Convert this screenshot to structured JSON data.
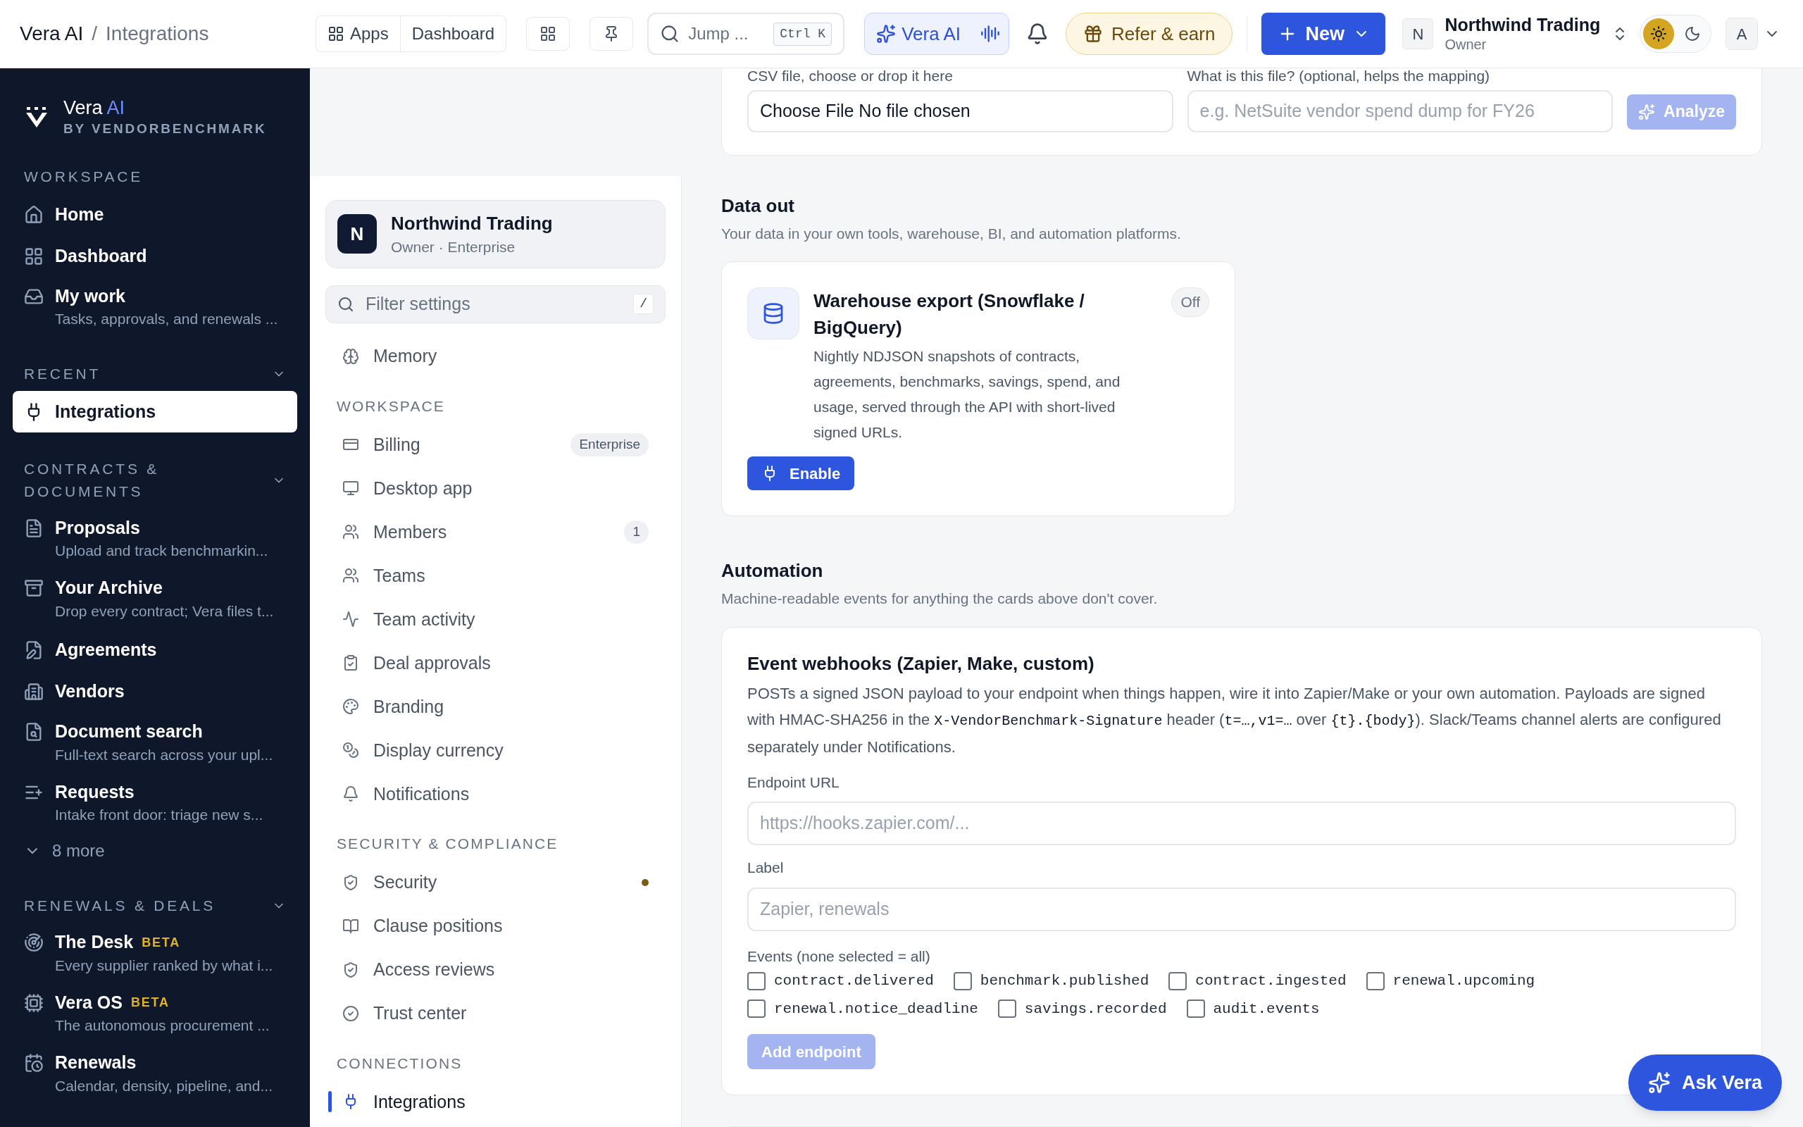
{
  "topbar": {
    "breadcrumb": [
      "Vera AI",
      "/",
      "Integrations"
    ],
    "apps_group": [
      {
        "label": "Apps",
        "kind": "grid"
      },
      {
        "label": "Dashboard"
      }
    ],
    "search": {
      "placeholder": "Jump ...",
      "shortcut": "Ctrl K"
    },
    "vera_button": "Vera AI",
    "refer_button": "Refer & earn",
    "new_button": "New",
    "account": {
      "initial": "N",
      "name": "Northwind Trading",
      "role": "Owner"
    },
    "theme": [
      {
        "kind": "light",
        "selected": true
      },
      {
        "kind": "dark",
        "selected": false
      }
    ],
    "user_initial": "A"
  },
  "sidebar": {
    "brand": {
      "name": "Vera",
      "accent": "AI",
      "subtitle": "BY VENDORBENCHMARK"
    },
    "sections": [
      {
        "title": "WORKSPACE",
        "collapsible": false,
        "items": [
          {
            "label": "Home",
            "kind": "home",
            "selected": false
          },
          {
            "label": "Dashboard",
            "kind": "dashboard",
            "selected": false
          },
          {
            "label": "My work",
            "subtitle": "Tasks, approvals, and renewals ...",
            "kind": "inbox",
            "selected": false
          }
        ]
      },
      {
        "title": "RECENT",
        "collapsible": true,
        "items": [
          {
            "label": "Integrations",
            "kind": "plug",
            "selected": true
          }
        ]
      },
      {
        "title": "CONTRACTS & DOCUMENTS",
        "collapsible": true,
        "items": [
          {
            "label": "Proposals",
            "subtitle": "Upload and track benchmarkin...",
            "kind": "file",
            "selected": false
          },
          {
            "label": "Your Archive",
            "subtitle": "Drop every contract; Vera files t...",
            "kind": "archive",
            "selected": false
          },
          {
            "label": "Agreements",
            "kind": "filepen",
            "selected": false
          },
          {
            "label": "Vendors",
            "kind": "building",
            "selected": false
          },
          {
            "label": "Document search",
            "subtitle": "Full-text search across your upl...",
            "kind": "filesearch",
            "selected": false
          },
          {
            "label": "Requests",
            "subtitle": "Intake front door: triage new s...",
            "kind": "listplus",
            "selected": false
          }
        ],
        "more": "8 more"
      },
      {
        "title": "RENEWALS & DEALS",
        "collapsible": true,
        "items": [
          {
            "label": "The Desk",
            "badge": "BETA",
            "subtitle": "Every supplier ranked by what i...",
            "kind": "radar",
            "selected": false
          },
          {
            "label": "Vera OS",
            "badge": "BETA",
            "subtitle": "The autonomous procurement ...",
            "kind": "cpu",
            "selected": false
          },
          {
            "label": "Renewals",
            "subtitle": "Calendar, density, pipeline, and...",
            "kind": "calendar",
            "selected": false
          }
        ]
      }
    ]
  },
  "settings_nav": {
    "org": {
      "initial": "N",
      "name": "Northwind Trading",
      "detail": "Owner · Enterprise"
    },
    "filter": {
      "placeholder": "Filter settings",
      "shortcut": "/"
    },
    "groups": [
      {
        "items": [
          {
            "label": "Memory",
            "kind": "brain",
            "selected": false
          }
        ]
      },
      {
        "title": "WORKSPACE",
        "items": [
          {
            "label": "Billing",
            "kind": "card",
            "selected": false,
            "badge": "Enterprise"
          },
          {
            "label": "Desktop app",
            "kind": "monitor",
            "selected": false
          },
          {
            "label": "Members",
            "kind": "users",
            "selected": false,
            "badge": "1"
          },
          {
            "label": "Teams",
            "kind": "users",
            "selected": false
          },
          {
            "label": "Team activity",
            "kind": "activity",
            "selected": false
          },
          {
            "label": "Deal approvals",
            "kind": "clipboard",
            "selected": false
          },
          {
            "label": "Branding",
            "kind": "palette",
            "selected": false
          },
          {
            "label": "Display currency",
            "kind": "coins",
            "selected": false
          },
          {
            "label": "Notifications",
            "kind": "bell",
            "selected": false
          }
        ]
      },
      {
        "title": "SECURITY & COMPLIANCE",
        "items": [
          {
            "label": "Security",
            "kind": "shield",
            "selected": false,
            "color": "#7c5c14"
          },
          {
            "label": "Clause positions",
            "kind": "book",
            "selected": false
          },
          {
            "label": "Access reviews",
            "kind": "shield",
            "selected": false
          },
          {
            "label": "Trust center",
            "kind": "check",
            "selected": false
          }
        ]
      },
      {
        "title": "CONNECTIONS",
        "items": [
          {
            "label": "Integrations",
            "kind": "plug",
            "selected": true
          }
        ]
      }
    ]
  },
  "import_card": {
    "file_label": "CSV file, choose or drop it here",
    "file_value": "Choose File No file chosen",
    "desc_label": "What is this file? (optional, helps the mapping)",
    "desc_placeholder": "e.g. NetSuite vendor spend dump for FY26",
    "analyze": "Analyze",
    "analyze_disabled": true
  },
  "data_out": {
    "title": "Data out",
    "subtitle": "Your data in your own tools, warehouse, BI, and automation platforms.",
    "cards": [
      {
        "title": "Warehouse export (Snowflake / BigQuery)",
        "status": "Off",
        "on": false,
        "description": "Nightly NDJSON snapshots of contracts, agreements, benchmarks, savings, spend, and usage, served through the API with short-lived signed URLs.",
        "button": "Enable"
      }
    ]
  },
  "automation": {
    "title": "Automation",
    "subtitle": "Machine-readable events for anything the cards above don't cover.",
    "webhook": {
      "title": "Event webhooks (Zapier, Make, custom)",
      "description": [
        {
          "kind": "text",
          "text": "POSTs a signed JSON payload to your endpoint when things happen, wire it into Zapier/Make or your own automation. Payloads are signed with HMAC-SHA256 in the "
        },
        {
          "kind": "code",
          "text": "X-VendorBenchmark-Signature"
        },
        {
          "kind": "text",
          "text": " header ("
        },
        {
          "kind": "code",
          "text": "t=…,v1=…"
        },
        {
          "kind": "text",
          "text": " over "
        },
        {
          "kind": "code",
          "text": "{t}.{body}"
        },
        {
          "kind": "text",
          "text": "). Slack/Teams channel alerts are configured separately under Notifications."
        }
      ],
      "fields": [
        {
          "label": "Endpoint URL",
          "placeholder": "https://hooks.zapier.com/..."
        },
        {
          "label": "Label",
          "placeholder": "Zapier, renewals"
        }
      ],
      "events_label": "Events (none selected = all)",
      "events": [
        {
          "name": "contract.delivered",
          "checked": false
        },
        {
          "name": "benchmark.published",
          "checked": false
        },
        {
          "name": "contract.ingested",
          "checked": false
        },
        {
          "name": "renewal.upcoming",
          "checked": false
        },
        {
          "name": "renewal.notice_deadline",
          "checked": false
        },
        {
          "name": "savings.recorded",
          "checked": false
        },
        {
          "name": "audit.events",
          "checked": false
        }
      ],
      "button": "Add endpoint",
      "button_disabled": true
    }
  },
  "ask_vera": "Ask Vera"
}
